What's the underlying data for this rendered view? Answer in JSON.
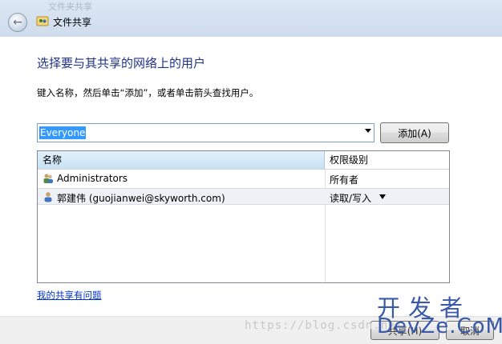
{
  "window": {
    "title": "文件共享",
    "ghost_title": "文件夹共享"
  },
  "main": {
    "heading": "选择要与其共享的网络上的用户",
    "instruction": "键入名称，然后单击“添加”，或者单击箭头查找用户。",
    "name_input_value": "Everyone",
    "add_button_label": "添加(A)"
  },
  "table": {
    "columns": [
      "名称",
      "权限级别"
    ],
    "rows": [
      {
        "name": "Administrators",
        "permission": "所有者",
        "icon": "user-group-icon"
      },
      {
        "name": "郭建伟 (guojianwei@skyworth.com)",
        "permission": "读取/写入",
        "icon": "user-icon"
      }
    ]
  },
  "help_link": "我的共享有问题",
  "footer": {
    "share_button_label": "共享(H)",
    "cancel_button_label": "取消"
  },
  "watermark": {
    "url": "https://blog.csdn.net",
    "brand_cn": "开发者",
    "brand_en": "DevZe.CoM"
  }
}
